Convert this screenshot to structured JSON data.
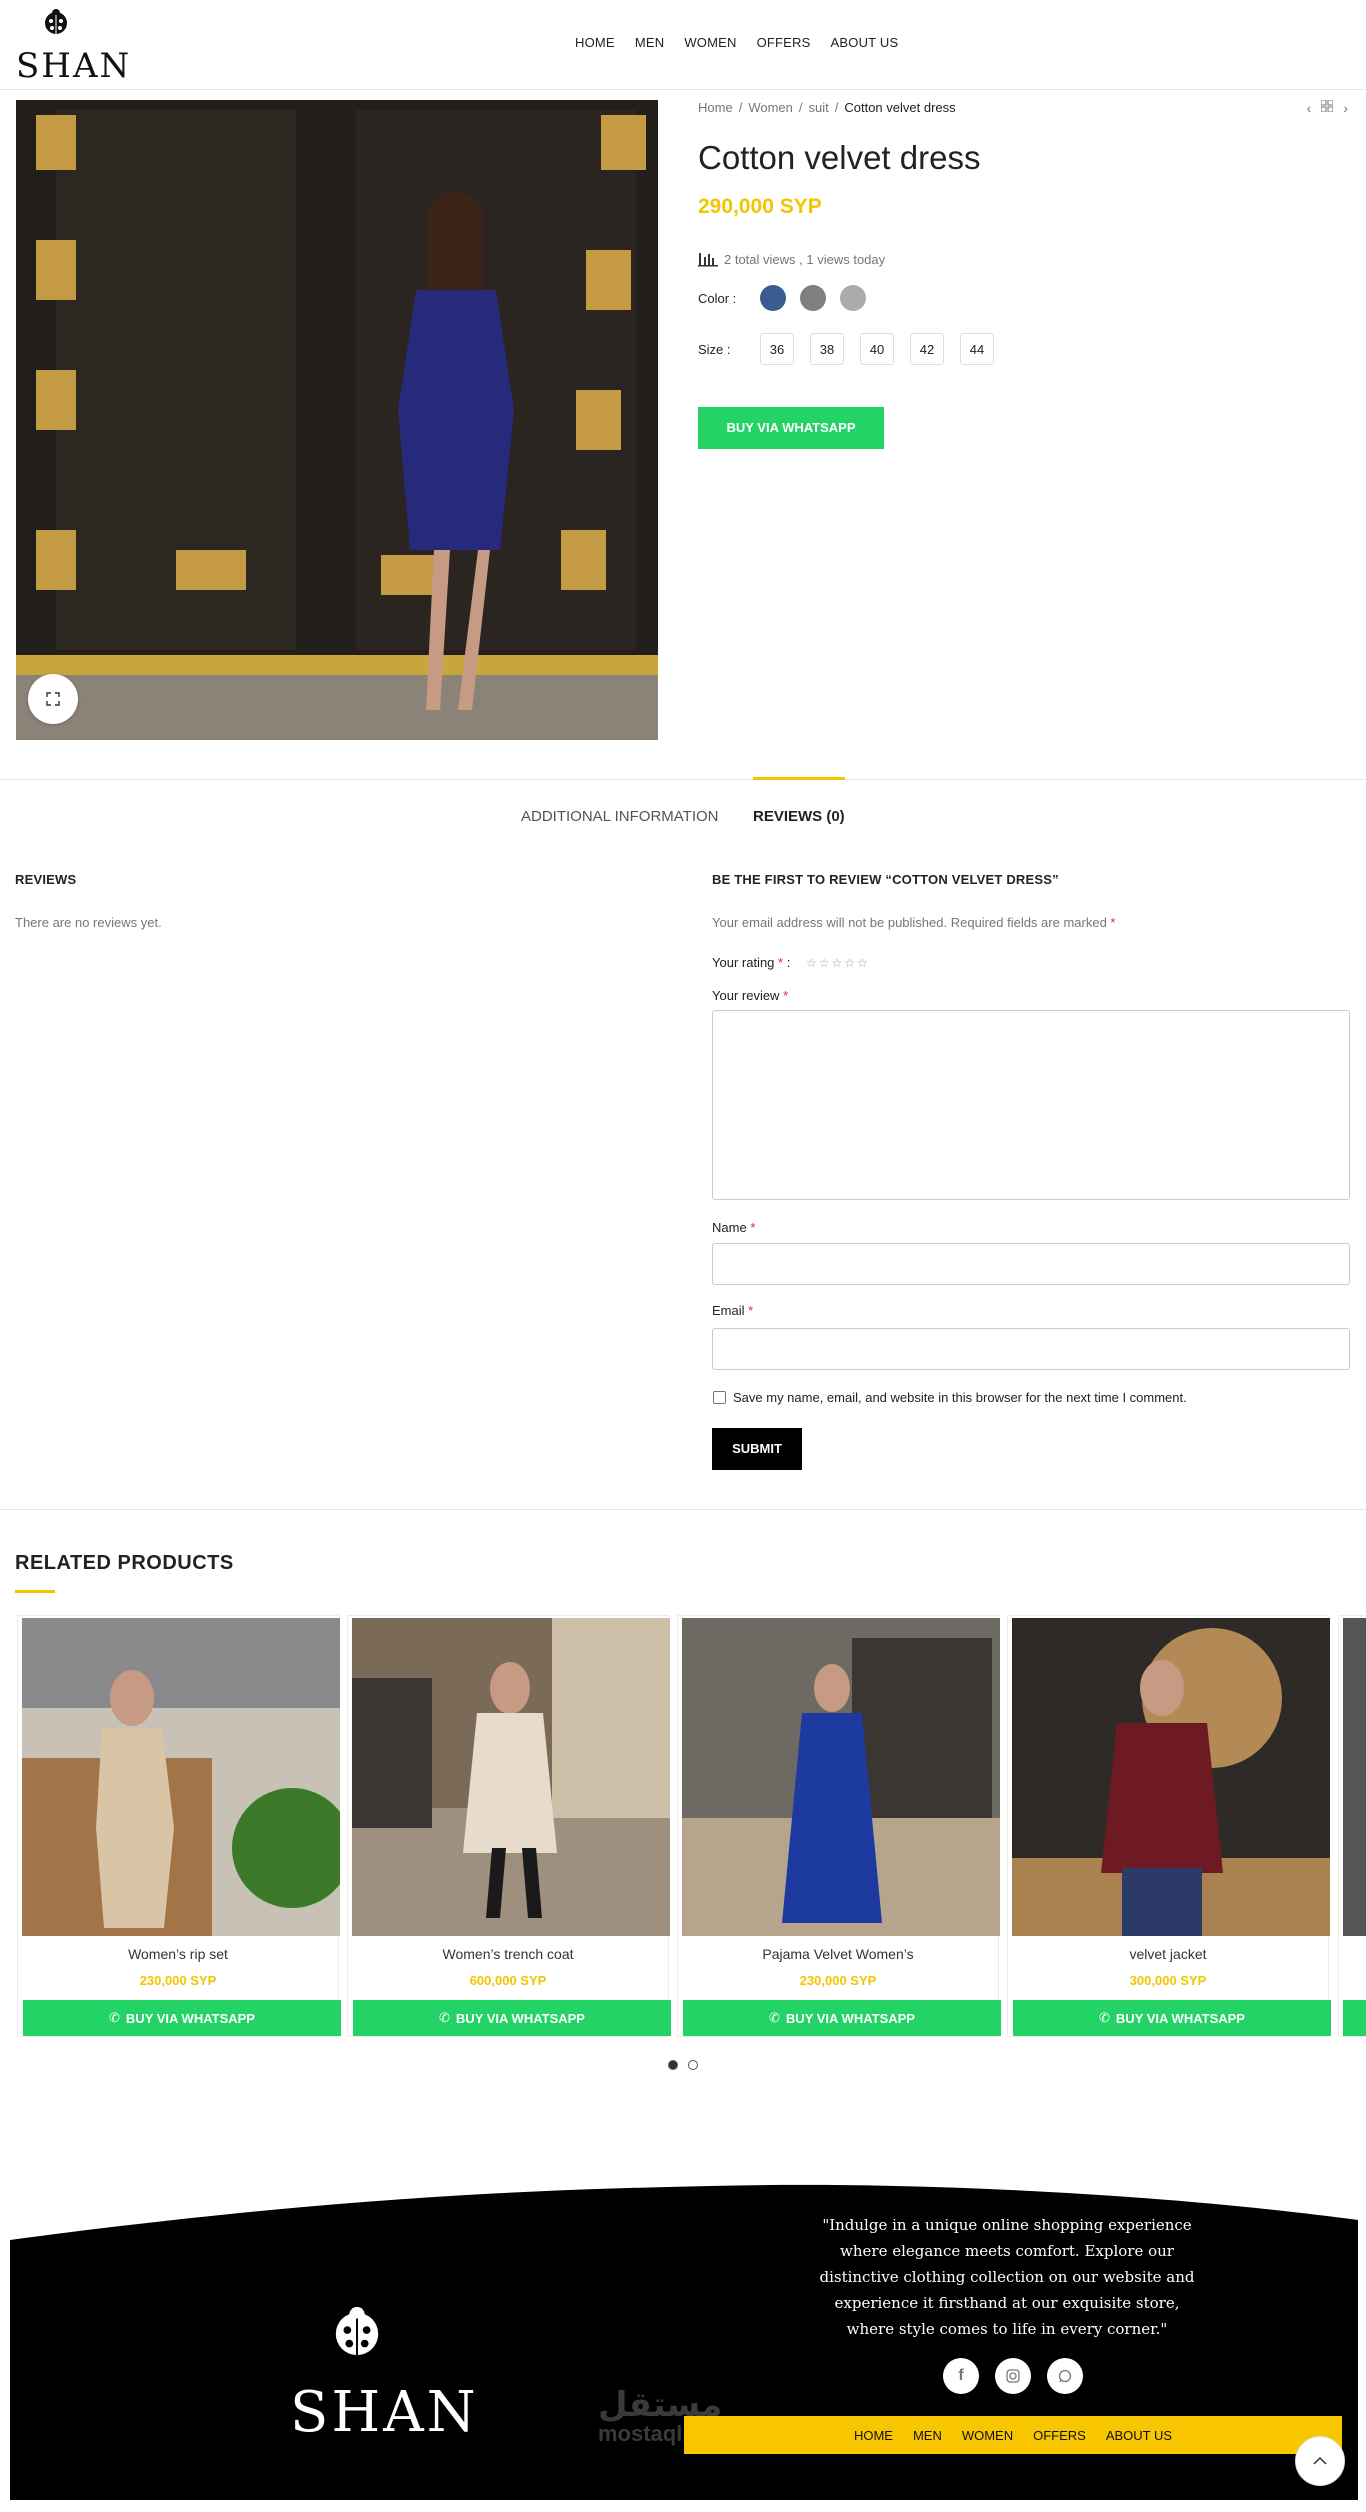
{
  "header": {
    "logo_text": "SHAN",
    "nav": [
      "HOME",
      "MEN",
      "WOMEN",
      "OFFERS",
      "ABOUT US"
    ]
  },
  "breadcrumb": [
    "Home",
    "Women",
    "suit",
    "Cotton velvet dress"
  ],
  "product": {
    "title": "Cotton velvet dress",
    "price": "290,000 SYP",
    "views": "2 total views , 1 views today",
    "color_label": "Color :",
    "colors": [
      "#3b5c8f",
      "#7f7f7f",
      "#ababab"
    ],
    "size_label": "Size :",
    "sizes": [
      "36",
      "38",
      "40",
      "42",
      "44"
    ],
    "buy_label": "BUY VIA WHATSAPP"
  },
  "tabs": {
    "additional": "ADDITIONAL INFORMATION",
    "reviews": "REVIEWS (0)"
  },
  "reviews": {
    "heading": "REVIEWS",
    "empty": "There are no reviews yet.",
    "form_heading": "BE THE FIRST TO REVIEW “COTTON VELVET DRESS”",
    "notice": "Your email address will not be published. Required fields are marked",
    "rating_label": "Your rating",
    "review_label": "Your review",
    "name_label": "Name",
    "email_label": "Email",
    "cookie_label": "Save my name, email, and website in this browser for the next time I comment.",
    "submit": "SUBMIT",
    "req": "*",
    "rating_colon": ":"
  },
  "related": {
    "title": "RELATED PRODUCTS",
    "items": [
      {
        "name": "Women’s rip set",
        "price": "230,000 SYP",
        "button": "BUY VIA WHATSAPP"
      },
      {
        "name": "Women’s trench coat",
        "price": "600,000 SYP",
        "button": "BUY VIA WHATSAPP"
      },
      {
        "name": "Pajama Velvet Women’s",
        "price": "230,000 SYP",
        "button": "BUY VIA WHATSAPP"
      },
      {
        "name": "velvet jacket",
        "price": "300,000 SYP",
        "button": "BUY VIA WHATSAPP"
      }
    ]
  },
  "footer": {
    "quote": "\"Indulge in a unique online shopping experience where elegance meets comfort. Explore our distinctive clothing collection on our website and experience it firsthand at our exquisite store, where style comes to life in every corner.\"",
    "logo_text": "SHAN",
    "nav": [
      "HOME",
      "MEN",
      "WOMEN",
      "OFFERS",
      "ABOUT US"
    ],
    "watermark": "مستقل",
    "watermark_sub": "mostaql.com"
  },
  "colors": {
    "accent": "#f3c500",
    "whatsapp": "#24d366"
  }
}
